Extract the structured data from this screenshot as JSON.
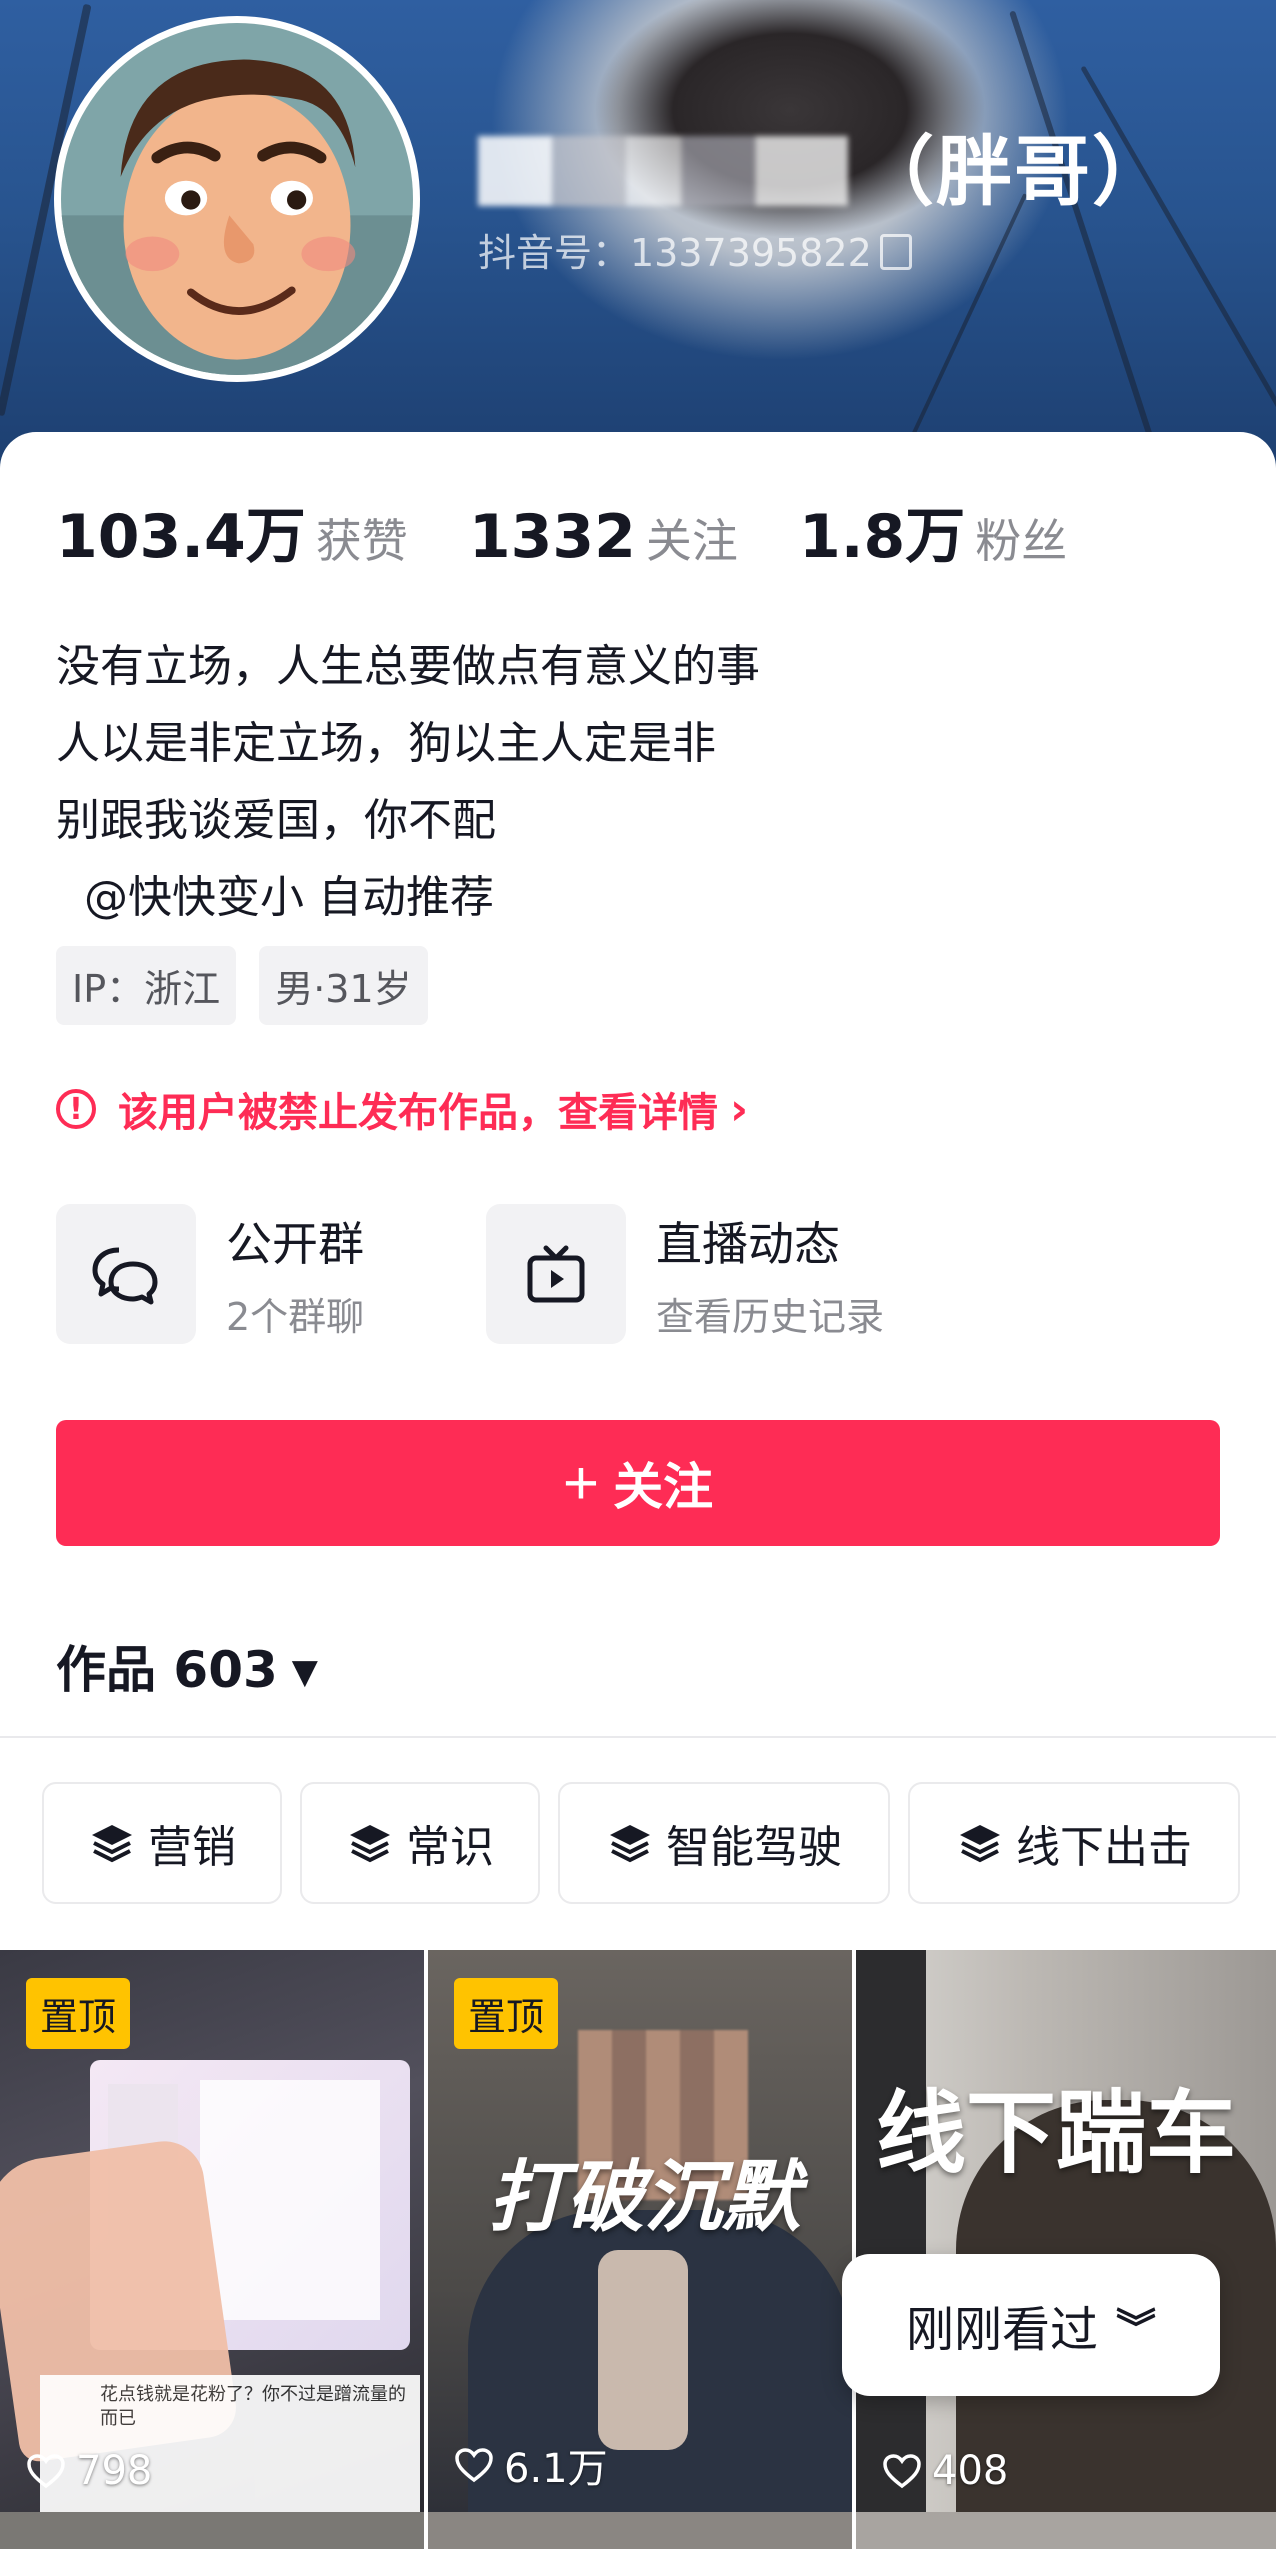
{
  "profile": {
    "nickname_visible": "（胖哥）",
    "douyin_id": "抖音号：1337395822"
  },
  "stats": [
    {
      "num": "103.4万",
      "label": "获赞"
    },
    {
      "num": "1332",
      "label": "关注"
    },
    {
      "num": "1.8万",
      "label": "粉丝"
    }
  ],
  "bio": [
    "没有立场，人生总要做点有意义的事",
    "人以是非定立场，狗以主人定是非",
    "别跟我谈爱国，你不配",
    "  @快快变小 自动推荐"
  ],
  "tags": [
    "IP：浙江",
    "男·31岁"
  ],
  "ban_notice": {
    "text": "该用户被禁止发布作品，查看详情",
    "color": "#fe2c55"
  },
  "entries": [
    {
      "title": "公开群",
      "subtitle": "2个群聊",
      "icon": "chat-bubbles-icon"
    },
    {
      "title": "直播动态",
      "subtitle": "查看历史记录",
      "icon": "tv-play-icon"
    }
  ],
  "follow_button": {
    "label": "关注",
    "color": "#fe2c55"
  },
  "works": {
    "label": "作品 603"
  },
  "collections": [
    "营销",
    "常识",
    "智能驾驶",
    "线下出击"
  ],
  "videos": [
    {
      "pinned_label": "置顶",
      "likes": "798",
      "caption": "花点钱就是花粉了？你不过是蹭流量的而已"
    },
    {
      "pinned_label": "置顶",
      "likes": "6.1万",
      "overlay": "打破沉默"
    },
    {
      "likes": "408",
      "overlay": "线下踹车"
    }
  ],
  "recently_viewed": "刚刚看过"
}
